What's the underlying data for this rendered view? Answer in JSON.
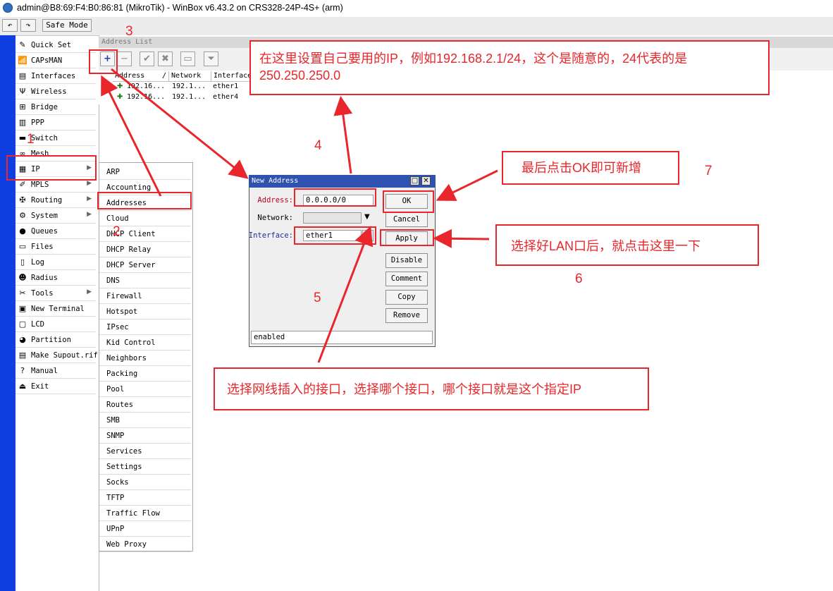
{
  "window": {
    "title": "admin@B8:69:F4:B0:86:81 (MikroTik) - WinBox v6.43.2 on CRS328-24P-4S+ (arm)"
  },
  "toolbar": {
    "undo_glyph": "↶",
    "redo_glyph": "↷",
    "safe_mode": "Safe Mode"
  },
  "menu": {
    "items": [
      {
        "label": "Quick Set",
        "icon": "quickset-icon",
        "glyph": "✎"
      },
      {
        "label": "CAPsMAN",
        "icon": "capsman-icon",
        "glyph": "📶"
      },
      {
        "label": "Interfaces",
        "icon": "interfaces-icon",
        "glyph": "▤"
      },
      {
        "label": "Wireless",
        "icon": "wireless-icon",
        "glyph": "Ψ"
      },
      {
        "label": "Bridge",
        "icon": "bridge-icon",
        "glyph": "⊞"
      },
      {
        "label": "PPP",
        "icon": "ppp-icon",
        "glyph": "▥"
      },
      {
        "label": "Switch",
        "icon": "switch-icon",
        "glyph": "▬"
      },
      {
        "label": "Mesh",
        "icon": "mesh-icon",
        "glyph": "∞"
      },
      {
        "label": "IP",
        "icon": "ip-icon",
        "glyph": "▦",
        "arrow": "▶"
      },
      {
        "label": "MPLS",
        "icon": "mpls-icon",
        "glyph": "✐",
        "arrow": "▶"
      },
      {
        "label": "Routing",
        "icon": "routing-icon",
        "glyph": "✠",
        "arrow": "▶"
      },
      {
        "label": "System",
        "icon": "system-icon",
        "glyph": "⚙",
        "arrow": "▶"
      },
      {
        "label": "Queues",
        "icon": "queues-icon",
        "glyph": "●"
      },
      {
        "label": "Files",
        "icon": "files-icon",
        "glyph": "▭"
      },
      {
        "label": "Log",
        "icon": "log-icon",
        "glyph": "▯"
      },
      {
        "label": "Radius",
        "icon": "radius-icon",
        "glyph": "☻"
      },
      {
        "label": "Tools",
        "icon": "tools-icon",
        "glyph": "✂",
        "arrow": "▶"
      },
      {
        "label": "New Terminal",
        "icon": "terminal-icon",
        "glyph": "▣"
      },
      {
        "label": "LCD",
        "icon": "lcd-icon",
        "glyph": "▢"
      },
      {
        "label": "Partition",
        "icon": "partition-icon",
        "glyph": "◕"
      },
      {
        "label": "Make Supout.rif",
        "icon": "supout-icon",
        "glyph": "▤"
      },
      {
        "label": "Manual",
        "icon": "manual-icon",
        "glyph": "?"
      },
      {
        "label": "Exit",
        "icon": "exit-icon",
        "glyph": "⏏"
      }
    ]
  },
  "address_list": {
    "title": "Address List",
    "tools": [
      {
        "icon": "add-icon",
        "glyph": "+"
      },
      {
        "icon": "remove-icon",
        "glyph": "−"
      },
      {
        "icon": "enable-icon",
        "glyph": "✔"
      },
      {
        "icon": "disable-icon",
        "glyph": "✖"
      },
      {
        "icon": "comment-icon",
        "glyph": "▭"
      },
      {
        "icon": "filter-icon",
        "glyph": "⏷"
      }
    ],
    "columns": [
      "Address",
      "/",
      "Network",
      "Interface"
    ],
    "rows": [
      {
        "address": "192.16...",
        "network": "192.1...",
        "interface": "ether1"
      },
      {
        "address": "192.16...",
        "network": "192.1...",
        "interface": "ether4"
      }
    ]
  },
  "ip_submenu": {
    "items": [
      "ARP",
      "Accounting",
      "Addresses",
      "Cloud",
      "DHCP Client",
      "DHCP Relay",
      "DHCP Server",
      "DNS",
      "Firewall",
      "Hotspot",
      "IPsec",
      "Kid Control",
      "Neighbors",
      "Packing",
      "Pool",
      "Routes",
      "SMB",
      "SNMP",
      "Services",
      "Settings",
      "Socks",
      "TFTP",
      "Traffic Flow",
      "UPnP",
      "Web Proxy"
    ]
  },
  "dialog": {
    "title": "New Address",
    "restore_glyph": "□",
    "close_glyph": "✕",
    "address_label": "Address:",
    "address_value": "0.0.0.0/0",
    "network_label": "Network:",
    "network_value": "",
    "network_arrow": "▼",
    "interface_label": "Interface:",
    "interface_value": "ether1",
    "interface_arrow": "⏷",
    "buttons": [
      "OK",
      "Cancel",
      "Apply",
      "Disable",
      "Comment",
      "Copy",
      "Remove"
    ],
    "status": "enabled"
  },
  "annotations": {
    "numbers": [
      "1",
      "2",
      "3",
      "4",
      "5",
      "6",
      "7"
    ],
    "note_ip": "在这里设置自己要用的IP，例如192.168.2.1/24，这个是随意的，24代表的是250.250.250.0",
    "note_ok": "最后点击OK即可新增",
    "note_apply": "选择好LAN口后，就点击这里一下",
    "note_interface": "选择网线插入的接口，选择哪个接口，哪个接口就是这个指定IP"
  },
  "colors": {
    "annotation_red": "#e8262b",
    "dialog_title_blue": "#2f52b0",
    "strip_blue": "#0f3fe0"
  }
}
